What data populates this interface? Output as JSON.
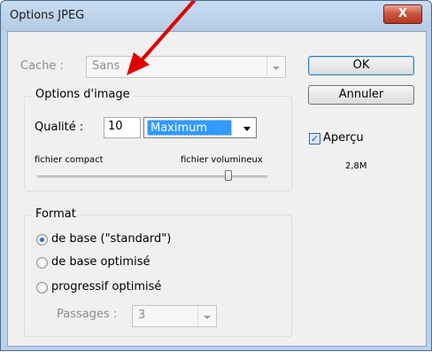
{
  "window": {
    "title": "Options JPEG",
    "close_label": "X"
  },
  "cache": {
    "label": "Cache :",
    "value": "Sans"
  },
  "buttons": {
    "ok": "OK",
    "cancel": "Annuler"
  },
  "preview": {
    "label": "Aperçu",
    "checked": true,
    "size": "2,8M"
  },
  "image_options": {
    "legend": "Options d'image",
    "quality_label": "Qualité :",
    "quality_value": "10",
    "quality_preset": "Maximum",
    "slider_min_label": "fichier compact",
    "slider_max_label": "fichier volumineux",
    "slider_level": 0.83
  },
  "format": {
    "legend": "Format",
    "options": [
      {
        "label": "de base  (\"standard\")",
        "selected": true
      },
      {
        "label": "de base optimisé",
        "selected": false
      },
      {
        "label": "progressif optimisé",
        "selected": false
      }
    ],
    "passes_label": "Passages :",
    "passes_value": "3"
  },
  "colors": {
    "annotation_arrow": "#e00000",
    "accent": "#3399ff"
  }
}
